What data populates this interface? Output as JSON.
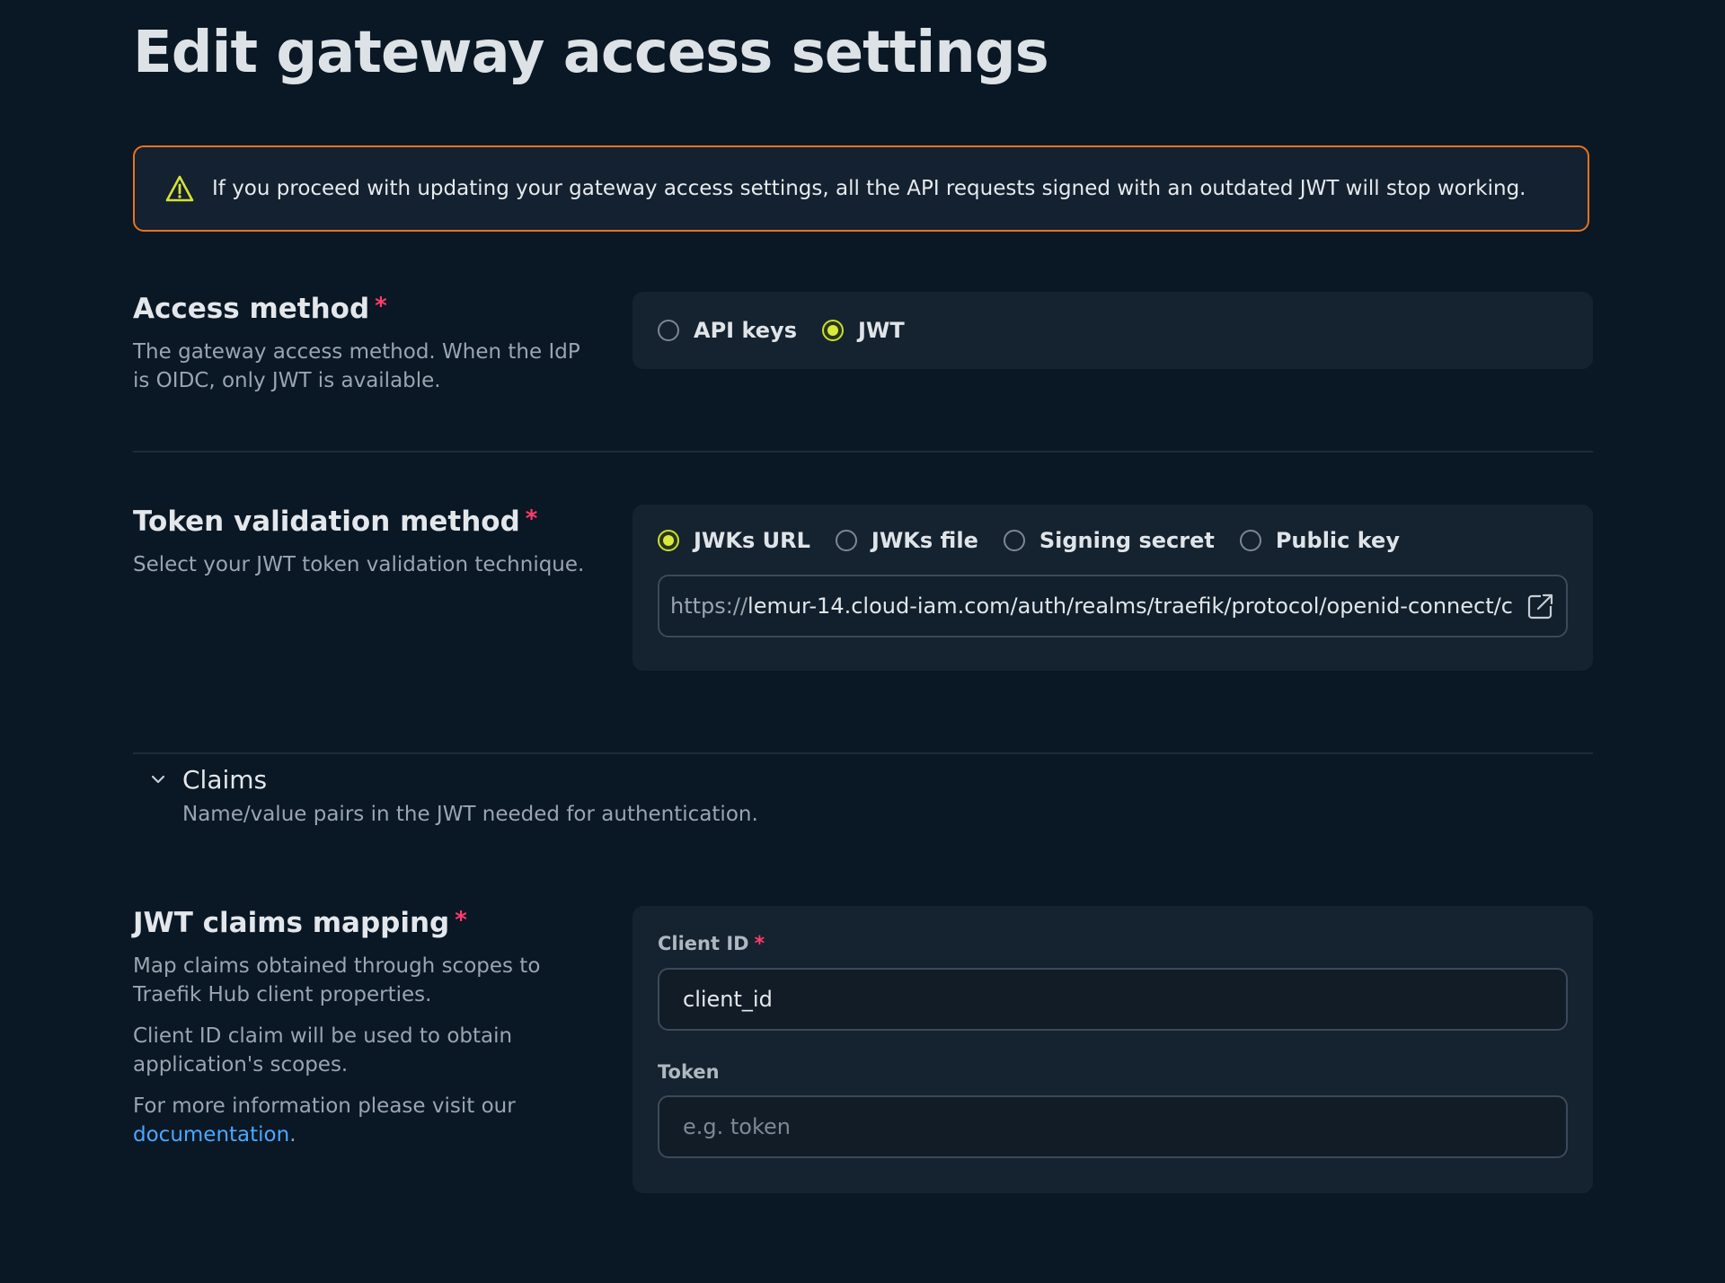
{
  "page": {
    "title": "Edit gateway access settings"
  },
  "warning": {
    "icon": "warning-triangle-icon",
    "text": "If you proceed with updating your gateway access settings, all the API requests signed with an outdated JWT will stop working."
  },
  "access_method": {
    "label": "Access method",
    "required": "*",
    "description": "The gateway access method. When the IdP is OIDC, only JWT is available.",
    "options": [
      {
        "label": "API keys",
        "checked": false
      },
      {
        "label": "JWT",
        "checked": true
      }
    ]
  },
  "token_validation": {
    "label": "Token validation method",
    "required": "*",
    "description": "Select your JWT token validation technique.",
    "options": [
      {
        "label": "JWKs URL",
        "checked": true
      },
      {
        "label": "JWKs file",
        "checked": false
      },
      {
        "label": "Signing secret",
        "checked": false
      },
      {
        "label": "Public key",
        "checked": false
      }
    ],
    "url_prefix": "https://",
    "url_rest": "lemur-14.cloud-iam.com/auth/realms/traefik/protocol/openid-connect/c"
  },
  "claims": {
    "title": "Claims",
    "description": "Name/value pairs in the JWT needed for authentication."
  },
  "claims_mapping": {
    "label": "JWT claims mapping",
    "required": "*",
    "desc1": "Map claims obtained through scopes to Traefik Hub client properties.",
    "desc2": "Client ID claim will be used to obtain application's scopes.",
    "desc3_prefix": "For more information please visit our ",
    "desc3_link": "documentation",
    "desc3_suffix": ".",
    "client_id_label": "Client ID",
    "client_id_value": "client_id",
    "token_label": "Token",
    "token_placeholder": "e.g. token"
  },
  "colors": {
    "accent": "#d9ea3a",
    "warning_border": "#e8731c",
    "required": "#ff3b6b",
    "link": "#4aa8ff"
  }
}
